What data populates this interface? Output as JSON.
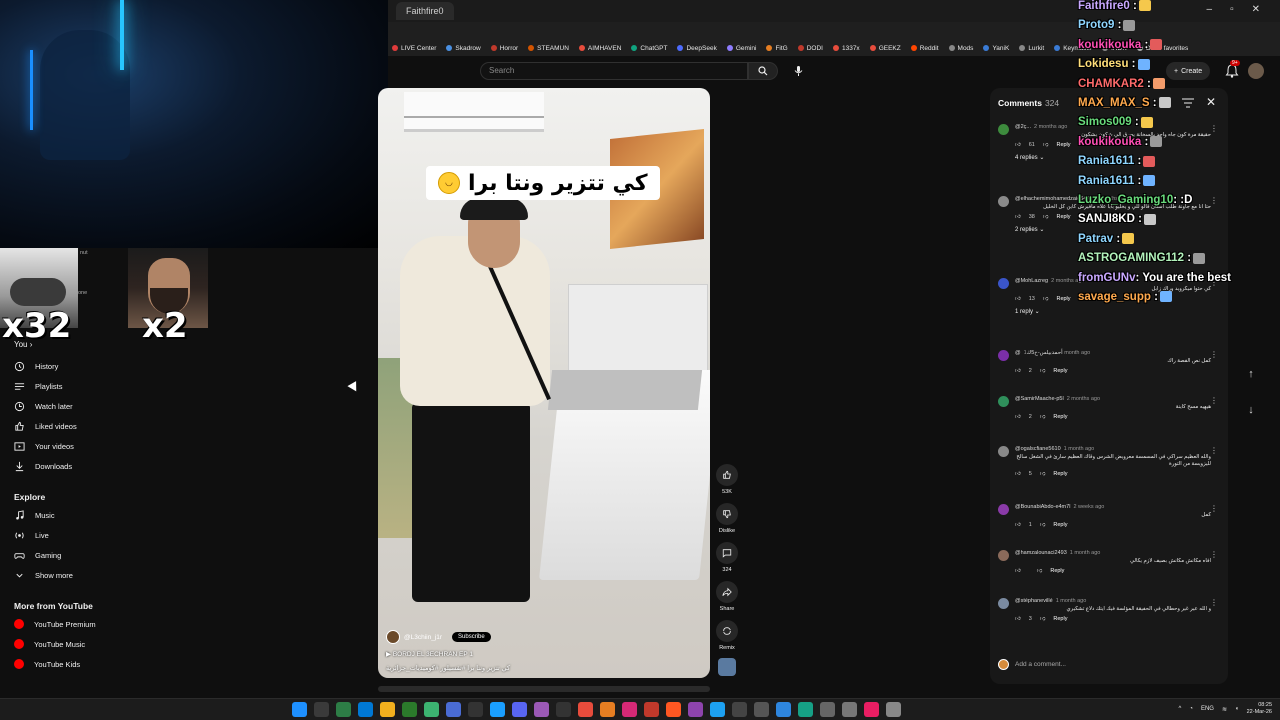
{
  "browser": {
    "tabs": [
      "Faithfire0"
    ],
    "bookmarks": [
      {
        "label": "LIVE Center",
        "color": "#e03b3b"
      },
      {
        "label": "Skadrow",
        "color": "#4a90e2"
      },
      {
        "label": "Horror",
        "color": "#c0392b"
      },
      {
        "label": "STEAMUN",
        "color": "#d35400"
      },
      {
        "label": "AIMHAVEN",
        "color": "#e74c3c"
      },
      {
        "label": "ChatGPT",
        "color": "#10a37f"
      },
      {
        "label": "DeepSeek",
        "color": "#4d6bfe"
      },
      {
        "label": "Gemini",
        "color": "#8e7cff"
      },
      {
        "label": "FitG",
        "color": "#e67e22"
      },
      {
        "label": "DODI",
        "color": "#c0392b"
      },
      {
        "label": "1337x",
        "color": "#e74c3c"
      },
      {
        "label": "GEEKZ",
        "color": "#e74c3c"
      },
      {
        "label": "Reddit",
        "color": "#ff4500"
      },
      {
        "label": "Mods",
        "color": "#888888"
      },
      {
        "label": "YaniK",
        "color": "#3a7bd5"
      },
      {
        "label": "Lurkit",
        "color": "#888888"
      },
      {
        "label": "Keymailer",
        "color": "#3a7bd5"
      },
      {
        "label": "IRDK",
        "color": "#888888"
      },
      {
        "label": "Other favorites",
        "color": "#aaaaaa"
      }
    ]
  },
  "header": {
    "search_placeholder": "Search",
    "create_label": "Create",
    "notif_badge": "9+"
  },
  "sidebar": {
    "you_label": "You",
    "items": [
      {
        "label": "History",
        "icon": "history-icon"
      },
      {
        "label": "Playlists",
        "icon": "playlists-icon"
      },
      {
        "label": "Watch later",
        "icon": "clock-icon"
      },
      {
        "label": "Liked videos",
        "icon": "thumbs-up-icon"
      },
      {
        "label": "Your videos",
        "icon": "video-icon"
      },
      {
        "label": "Downloads",
        "icon": "download-icon"
      }
    ],
    "explore_heading": "Explore",
    "explore_items": [
      {
        "label": "Music",
        "icon": "music-icon"
      },
      {
        "label": "Live",
        "icon": "live-icon"
      },
      {
        "label": "Gaming",
        "icon": "gaming-icon"
      },
      {
        "label": "Show more",
        "icon": "chevron-down-icon"
      }
    ],
    "more_heading": "More from YouTube",
    "more_items": [
      {
        "label": "YouTube Premium"
      },
      {
        "label": "YouTube Music"
      },
      {
        "label": "YouTube Kids"
      }
    ]
  },
  "overlays": {
    "multiplier_left": "x32",
    "multiplier_right": "x2",
    "snippet_1": "nut",
    "snippet_2": "one"
  },
  "player": {
    "caption": "كي تتزير ونتا برا",
    "channel": "@L3chiin_j1r",
    "subscribe_label": "Subscribe",
    "title_line": "BORDJ EL 3ECHRAN EP 1",
    "hashtags_line": "كي تتزير ونتا برا #تقسيلور #كوميديات_جزائرية"
  },
  "actions": {
    "likes": "53K",
    "dislike_label": "Dislike",
    "comments_count": "324",
    "share_label": "Share",
    "remix_label": "Remix"
  },
  "comments": {
    "title": "Comments",
    "count": "324",
    "add_placeholder": "Add a comment...",
    "items": [
      {
        "author": "@2ç...",
        "time": "2 months ago",
        "text": "حقيقة مرة كون جاه واحد بالسخانة يحرق الي شكون بشكون",
        "likes": "61",
        "replies": "4 replies",
        "color": "#3d8b3d"
      },
      {
        "author": "@elhachemimohamedzaid6448",
        "time": "2 months ago",
        "text": "حتا انا مع جاونة طلب اسنان قالو للي و يخليو بابا علاه مافيرش كاين كل الخليل",
        "likes": "38",
        "replies": "2 replies",
        "color": "#8a8a8a"
      },
      {
        "author": "@MohLazreg",
        "time": "2 months ago",
        "text": "كي حتوا ميكرويد وراك زابل",
        "likes": "13",
        "replies": "1 reply",
        "color": "#3a55c9"
      },
      {
        "author": "@أحمدبيلس-خ5ك",
        "time": "1 month ago",
        "text": "كمل نص الفصة راك",
        "likes": "2",
        "replies": "",
        "color": "#7b2fa8"
      },
      {
        "author": "@SamirMaache-p5l",
        "time": "2 months ago",
        "text": "هيهيه مسح كاينة",
        "likes": "2",
        "replies": "",
        "color": "#2f8f5b"
      },
      {
        "author": "@ogalscfiane5610",
        "time": "1 month ago",
        "text": "والله العظيم سراكي في المسمسة معرويض الشرس وقاك العظيم سارئ في الشغل سالخ لليزويسة من التورة",
        "likes": "5",
        "replies": "",
        "color": "#888888"
      },
      {
        "author": "@BounabiAbdo-e4m7l",
        "time": "2 weeks ago",
        "text": "كمل",
        "likes": "1",
        "replies": "",
        "color": "#8a3aa8"
      },
      {
        "author": "@hamzalounaci2493",
        "time": "1 month ago",
        "text": "افاه مكانش مكانش بصيف لازم يكالي",
        "likes": "",
        "replies": "",
        "color": "#8a6a5a"
      },
      {
        "author": "@stéphanevillé",
        "time": "1 month ago",
        "text": "و الله عير غير وحطالي في الحفيقة المؤلسة فيك ايتك دلاع تشكيري",
        "likes": "3",
        "replies": "",
        "color": "#7a8aa0"
      }
    ]
  },
  "chat": [
    {
      "user": "Faithfire0",
      "msg": "",
      "color": "#c9a8ff"
    },
    {
      "user": "Proto9",
      "msg": "",
      "color": "#8fd6ff"
    },
    {
      "user": "koukikouka",
      "msg": "",
      "color": "#ff4fb5"
    },
    {
      "user": "Lokidesu",
      "msg": "",
      "color": "#ffde7a"
    },
    {
      "user": "CHAMKAR2",
      "msg": "",
      "color": "#ff6b6b"
    },
    {
      "user": "MAX_MAX_S",
      "msg": "",
      "color": "#ffa94d"
    },
    {
      "user": "Simos009",
      "msg": "",
      "color": "#69db7c"
    },
    {
      "user": "koukikouka",
      "msg": "",
      "color": "#ff4fb5"
    },
    {
      "user": "Rania1611",
      "msg": "",
      "color": "#8fd6ff"
    },
    {
      "user": "Rania1611",
      "msg": "",
      "color": "#8fd6ff"
    },
    {
      "user": "Luzko_Gaming10",
      "msg": ": :D",
      "color": "#69db7c"
    },
    {
      "user": "SANJI8KD",
      "msg": "",
      "color": "#ffffff"
    },
    {
      "user": "Patrav",
      "msg": "",
      "color": "#8fd6ff"
    },
    {
      "user": "ASTROGAMING112",
      "msg": "",
      "color": "#b2f2bb"
    },
    {
      "user": "fromGUNv",
      "msg": ": You are the best",
      "color": "#c9a8ff"
    },
    {
      "user": "savage_supp",
      "msg": "",
      "color": "#ffa94d"
    }
  ],
  "taskbar": {
    "lang": "ENG",
    "time": "08:25",
    "date": "22-Mar-26"
  }
}
